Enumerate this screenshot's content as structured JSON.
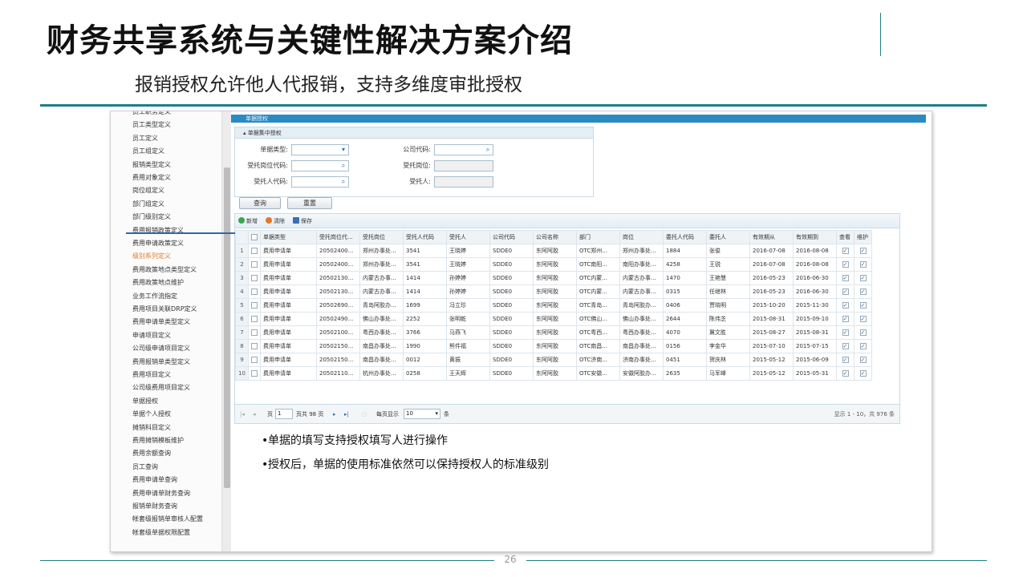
{
  "slide": {
    "title": "财务共享系统与关键性解决方案介绍",
    "subtitle": "报销授权允许他人代报销，支持多维度审批授权",
    "page_number": "26"
  },
  "side_menu": {
    "items": [
      {
        "label": "员工职务定义",
        "active": false
      },
      {
        "label": "员工类型定义",
        "active": false
      },
      {
        "label": "员工定义",
        "active": false
      },
      {
        "label": "员工组定义",
        "active": false
      },
      {
        "label": "报销类型定义",
        "active": false
      },
      {
        "label": "费用对象定义",
        "active": false
      },
      {
        "label": "岗位组定义",
        "active": false
      },
      {
        "label": "部门组定义",
        "active": false
      },
      {
        "label": "部门级别定义",
        "active": false
      },
      {
        "label": "费用报销政策定义",
        "active": false
      },
      {
        "label": "费用申请政策定义",
        "active": false
      },
      {
        "label": "级别系列定义",
        "active": true
      },
      {
        "label": "费用政策地点类型定义",
        "active": false
      },
      {
        "label": "费用政策地点维护",
        "active": false
      },
      {
        "label": "业务工作流指定",
        "active": false
      },
      {
        "label": "费用项目关联DRP定义",
        "active": false
      },
      {
        "label": "费用申请单类型定义",
        "active": false
      },
      {
        "label": "申请项目定义",
        "active": false
      },
      {
        "label": "公司级申请项目定义",
        "active": false
      },
      {
        "label": "费用报销单类型定义",
        "active": false
      },
      {
        "label": "费用项目定义",
        "active": false
      },
      {
        "label": "公司级费用项目定义",
        "active": false
      },
      {
        "label": "单据授权",
        "active": false
      },
      {
        "label": "单据个人授权",
        "active": false
      },
      {
        "label": "摊销科目定义",
        "active": false
      },
      {
        "label": "费用摊销模板维护",
        "active": false
      },
      {
        "label": "费用余额查询",
        "active": false
      },
      {
        "label": "员工查询",
        "active": false
      },
      {
        "label": "费用申请单查询",
        "active": false
      },
      {
        "label": "费用申请单财务查询",
        "active": false
      },
      {
        "label": "报销单财务查询",
        "active": false
      },
      {
        "label": "帐套级报销单审核人配置",
        "active": false
      },
      {
        "label": "帐套级单据权限配置",
        "active": false
      }
    ]
  },
  "top_tab": {
    "label": "单据授权"
  },
  "query_panel": {
    "header": "单据集中授权",
    "fields": {
      "doc_type_label": "单据类型:",
      "doc_type_value": "",
      "company_code_label": "公司代码:",
      "company_code_value": "",
      "post_code_label": "受托岗位代码:",
      "post_code_value": "",
      "post_label": "受托岗位:",
      "post_value": "",
      "person_code_label": "受托人代码:",
      "person_code_value": "",
      "person_label": "受托人:",
      "person_value": ""
    },
    "buttons": {
      "query": "查询",
      "reset": "重置"
    }
  },
  "grid": {
    "toolbar": {
      "add": "新增",
      "delete": "清除",
      "save": "保存"
    },
    "columns": [
      "单据类型",
      "受托岗位代...",
      "受托岗位",
      "受托人代码",
      "受托人",
      "公司代码",
      "公司名称",
      "部门",
      "岗位",
      "委托人代码",
      "委托人",
      "有效期从",
      "有效期到",
      "查看",
      "维护"
    ],
    "rows": [
      {
        "no": "1",
        "cells": [
          "费用申请单",
          "20502400...",
          "郑州办事处...",
          "3541",
          "王晓婷",
          "SDDE0",
          "东阿阿胶",
          "OTC郑州...",
          "郑州办事处...",
          "1884",
          "张俊",
          "2016-07-08",
          "2016-08-08"
        ]
      },
      {
        "no": "2",
        "cells": [
          "费用申请单",
          "20502400...",
          "郑州办事处...",
          "3541",
          "王晓婷",
          "SDDE0",
          "东阿阿胶",
          "OTC南阳...",
          "南阳办事处...",
          "4258",
          "王锐",
          "2016-07-08",
          "2016-08-08"
        ]
      },
      {
        "no": "3",
        "cells": [
          "费用申请单",
          "20502130...",
          "内蒙古办事...",
          "1414",
          "孙婷婷",
          "SDDE0",
          "东阿阿胶",
          "OTC内蒙...",
          "内蒙古办事...",
          "1470",
          "王艳慧",
          "2016-05-23",
          "2016-06-30"
        ]
      },
      {
        "no": "4",
        "cells": [
          "费用申请单",
          "20502130...",
          "内蒙古办事...",
          "1414",
          "孙婷婷",
          "SDDE0",
          "东阿阿胶",
          "OTC内蒙...",
          "内蒙古办事...",
          "0315",
          "任继林",
          "2016-05-23",
          "2016-06-30"
        ]
      },
      {
        "no": "5",
        "cells": [
          "费用申请单",
          "20502690...",
          "青岛阿胶办...",
          "1699",
          "冯立珍",
          "SDDE0",
          "东阿阿胶",
          "OTC青岛...",
          "青岛阿胶办...",
          "0406",
          "贾晓明",
          "2015-10-20",
          "2015-11-30"
        ]
      },
      {
        "no": "6",
        "cells": [
          "费用申请单",
          "20502490...",
          "佛山办事处...",
          "2252",
          "张明乾",
          "SDDE0",
          "东阿阿胶",
          "OTC佛山...",
          "佛山办事处...",
          "2644",
          "陈伟芝",
          "2015-08-31",
          "2015-09-10"
        ]
      },
      {
        "no": "7",
        "cells": [
          "费用申请单",
          "20502100...",
          "粤西办事处...",
          "3766",
          "马燕飞",
          "SDDE0",
          "东阿阿胶",
          "OTC粤西...",
          "粤西办事处...",
          "4070",
          "冀文胜",
          "2015-08-27",
          "2015-08-31"
        ]
      },
      {
        "no": "8",
        "cells": [
          "费用申请单",
          "20502150...",
          "南昌办事处...",
          "1990",
          "熊件福",
          "SDDE0",
          "东阿阿胶",
          "OTC南昌...",
          "南昌办事处...",
          "0156",
          "李金华",
          "2015-07-10",
          "2015-07-15"
        ]
      },
      {
        "no": "9",
        "cells": [
          "费用申请单",
          "20502150...",
          "南昌办事处...",
          "0012",
          "黄振",
          "SDDE0",
          "东阿阿胶",
          "OTC济南...",
          "济南办事处...",
          "0451",
          "贺庆林",
          "2015-05-12",
          "2015-06-09"
        ]
      },
      {
        "no": "10",
        "cells": [
          "费用申请单",
          "20502110...",
          "杭州办事处...",
          "0258",
          "王天辉",
          "SDDE0",
          "东阿阿胶",
          "OTC安徽...",
          "安徽阿胶办...",
          "2635",
          "马军峰",
          "2015-05-12",
          "2015-05-31"
        ]
      }
    ],
    "pager": {
      "page_prefix": "页",
      "page_value": "1",
      "total_pages": "页共 98 页",
      "per_page_label": "每页显示",
      "per_page_value": "10",
      "per_page_unit": "条",
      "summary": "显示 1 - 10，共 976 条"
    }
  },
  "bullets": [
    "单据的填写支持授权填写人进行操作",
    "授权后，单据的使用标准依然可以保持授权人的标准级别"
  ],
  "colors": {
    "accent": "#1f7f86",
    "tab_bar": "#2a8bc2",
    "active_menu": "#e07a2a",
    "annotation_line": "#2d6aa3"
  }
}
